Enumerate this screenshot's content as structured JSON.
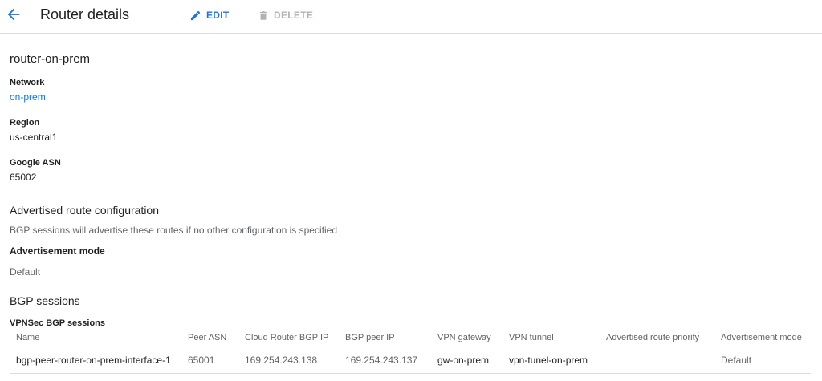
{
  "header": {
    "title": "Router details",
    "edit_label": "EDIT",
    "delete_label": "DELETE",
    "back_icon": "arrow-back-icon",
    "edit_icon": "pencil-icon",
    "delete_icon": "trash-icon",
    "accent_color": "#1a73e8",
    "disabled_color": "#b0b3b8"
  },
  "router": {
    "name": "router-on-prem",
    "network_label": "Network",
    "network_value": "on-prem",
    "region_label": "Region",
    "region_value": "us-central1",
    "asn_label": "Google ASN",
    "asn_value": "65002"
  },
  "advertised": {
    "title": "Advertised route configuration",
    "description": "BGP sessions will advertise these routes if no other configuration is specified",
    "mode_label": "Advertisement mode",
    "mode_value": "Default"
  },
  "bgp": {
    "title": "BGP sessions",
    "subtitle": "VPNSec BGP sessions",
    "columns": [
      "Name",
      "Peer ASN",
      "Cloud Router BGP IP",
      "BGP peer IP",
      "VPN gateway",
      "VPN tunnel",
      "Advertised route priority",
      "Advertisement mode"
    ],
    "rows": [
      [
        "bgp-peer-router-on-prem-interface-1",
        "65001",
        "169.254.243.138",
        "169.254.243.137",
        "gw-on-prem",
        "vpn-tunel-on-prem",
        "",
        "Default"
      ]
    ]
  }
}
